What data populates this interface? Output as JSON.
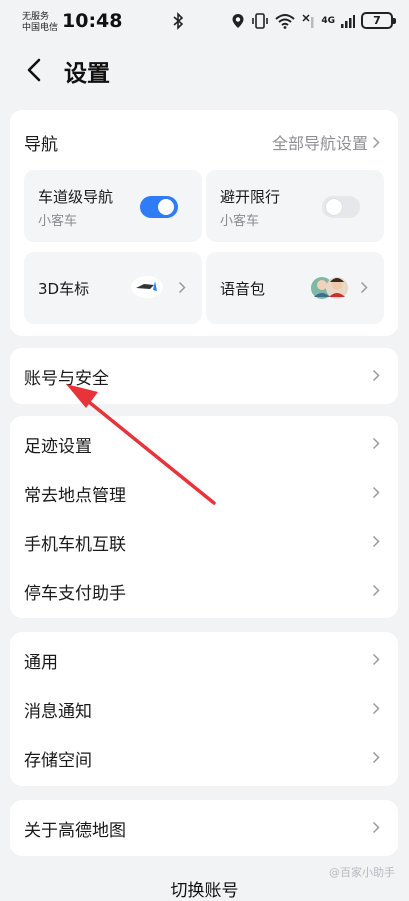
{
  "status_bar": {
    "carrier_line1": "无服务",
    "carrier_line2": "中国电信",
    "time": "10:48",
    "network": "4G",
    "battery": "7"
  },
  "header": {
    "title": "设置"
  },
  "navigation": {
    "title": "导航",
    "all_settings": "全部导航设置",
    "tiles": [
      {
        "title": "车道级导航",
        "subtitle": "小客车",
        "toggle": "on"
      },
      {
        "title": "避开限行",
        "subtitle": "小客车",
        "toggle": "off"
      },
      {
        "title": "3D车标"
      },
      {
        "title": "语音包"
      }
    ]
  },
  "account": {
    "label": "账号与安全"
  },
  "group2": [
    "足迹设置",
    "常去地点管理",
    "手机车机互联",
    "停车支付助手"
  ],
  "group3": [
    "通用",
    "消息通知",
    "存储空间"
  ],
  "about": {
    "label": "关于高德地图"
  },
  "bottom": {
    "label": "切换账号"
  },
  "watermark": "@百家小助手",
  "colors": {
    "accent": "#2e7cf6",
    "annotation_arrow": "#e8333a",
    "background": "#f2f3f5"
  }
}
